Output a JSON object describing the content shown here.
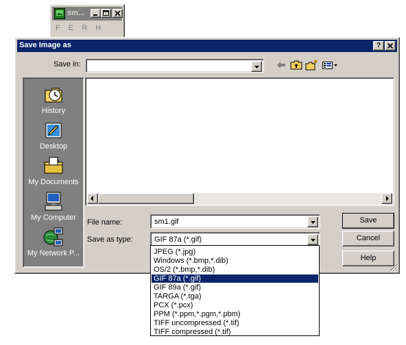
{
  "mini_window": {
    "title": "sm...",
    "menu": [
      "F",
      "E",
      "R",
      "H"
    ]
  },
  "dialog": {
    "title": "Save Image as",
    "title_buttons": {
      "help": "?",
      "close": "✕"
    },
    "save_in_label": "Save in:",
    "save_in_value": "",
    "places": [
      "History",
      "Desktop",
      "My Documents",
      "My Computer",
      "My Network P..."
    ],
    "file_name_label": "File name:",
    "file_name_value": "sm1.gif",
    "save_as_type_label": "Save as type:",
    "save_as_type_value": "GIF 87a (*.gif)",
    "buttons": {
      "save": "Save",
      "cancel": "Cancel",
      "help": "Help"
    }
  },
  "type_options": [
    "JPEG (*.jpg)",
    "Windows (*.bmp,*.dib)",
    "OS/2 (*.bmp,*.dib)",
    "GIF 87a (*.gif)",
    "GIF 89a (*.gif)",
    "TARGA (*.tga)",
    "PCX (*.pcx)",
    "PPM (*.ppm,*.pgm,*.pbm)",
    "TIFF uncompressed (*.tif)",
    "TIFF compressed (*.tif)"
  ],
  "selected_type_index": 3,
  "colors": {
    "face": "#d4d0c8",
    "titlebar_active": "#0a246a",
    "titlebar_inactive": "#808080",
    "places_bar": "#808080",
    "selection": "#0a246a"
  },
  "icons": {
    "back": "back-arrow-icon",
    "up": "up-folder-icon",
    "new_folder": "new-folder-icon",
    "view_menu": "view-menu-icon"
  }
}
